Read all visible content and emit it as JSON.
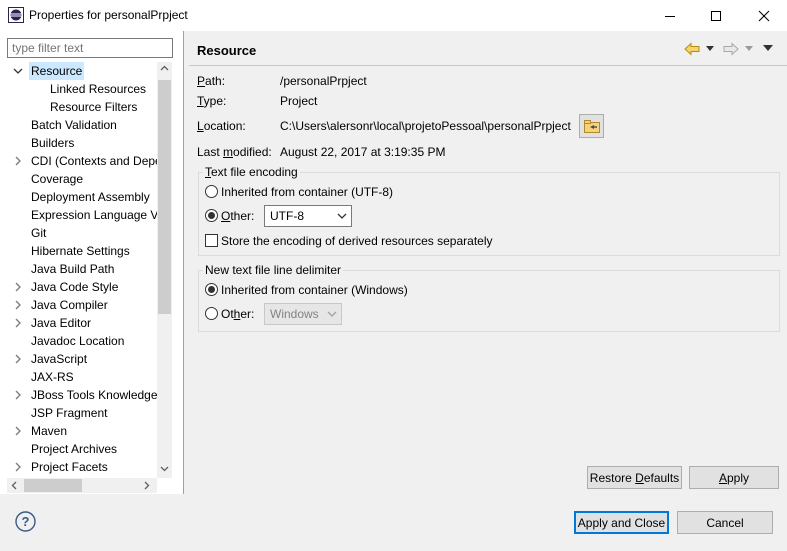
{
  "window": {
    "title": "Properties for personalPrpject",
    "minimize_icon": "minimize-icon",
    "maximize_icon": "maximize-icon",
    "close_icon": "close-icon"
  },
  "filter": {
    "placeholder": "type filter text"
  },
  "tree": {
    "items": [
      {
        "label": "Resource",
        "expanded": true,
        "selected": true
      },
      {
        "label": "Linked Resources",
        "child": true
      },
      {
        "label": "Resource Filters",
        "child": true
      },
      {
        "label": "Batch Validation"
      },
      {
        "label": "Builders"
      },
      {
        "label": "CDI (Contexts and Depe",
        "expandable": true
      },
      {
        "label": "Coverage"
      },
      {
        "label": "Deployment Assembly"
      },
      {
        "label": "Expression Language Va"
      },
      {
        "label": "Git"
      },
      {
        "label": "Hibernate Settings"
      },
      {
        "label": "Java Build Path"
      },
      {
        "label": "Java Code Style",
        "expandable": true
      },
      {
        "label": "Java Compiler",
        "expandable": true
      },
      {
        "label": "Java Editor",
        "expandable": true
      },
      {
        "label": "Javadoc Location"
      },
      {
        "label": "JavaScript",
        "expandable": true
      },
      {
        "label": "JAX-RS"
      },
      {
        "label": "JBoss Tools Knowledge",
        "expandable": true
      },
      {
        "label": "JSP Fragment"
      },
      {
        "label": "Maven",
        "expandable": true
      },
      {
        "label": "Project Archives"
      },
      {
        "label": "Project Facets",
        "expandable": true
      }
    ]
  },
  "page": {
    "title": "Resource",
    "path_label": "Path:",
    "path_value": "/personalPrpject",
    "type_label": "Type:",
    "type_value": "Project",
    "location_label": "Location:",
    "location_value": "C:\\Users\\alersonr\\local\\projetoPessoal\\personalPrpject",
    "last_modified_label": "Last modified:",
    "last_modified_value": "August 22, 2017 at 3:19:35 PM"
  },
  "encoding": {
    "group_title": "Text file encoding",
    "inherited_label": "Inherited from container (UTF-8)",
    "inherited_selected": false,
    "other_label": "Other:",
    "other_selected": true,
    "other_value": "UTF-8",
    "store_derived_label": "Store the encoding of derived resources separately",
    "store_derived_checked": false
  },
  "delimiter": {
    "group_title": "New text file line delimiter",
    "inherited_label": "Inherited from container (Windows)",
    "inherited_selected": true,
    "other_label": "Other:",
    "other_selected": false,
    "other_value": "Windows"
  },
  "buttons": {
    "restore_defaults": "Restore Defaults",
    "apply": "Apply",
    "apply_and_close": "Apply and Close",
    "cancel": "Cancel"
  },
  "colors": {
    "selection": "#cce8ff",
    "accent": "#0078d7",
    "panel_bg": "#f0f0f0"
  }
}
